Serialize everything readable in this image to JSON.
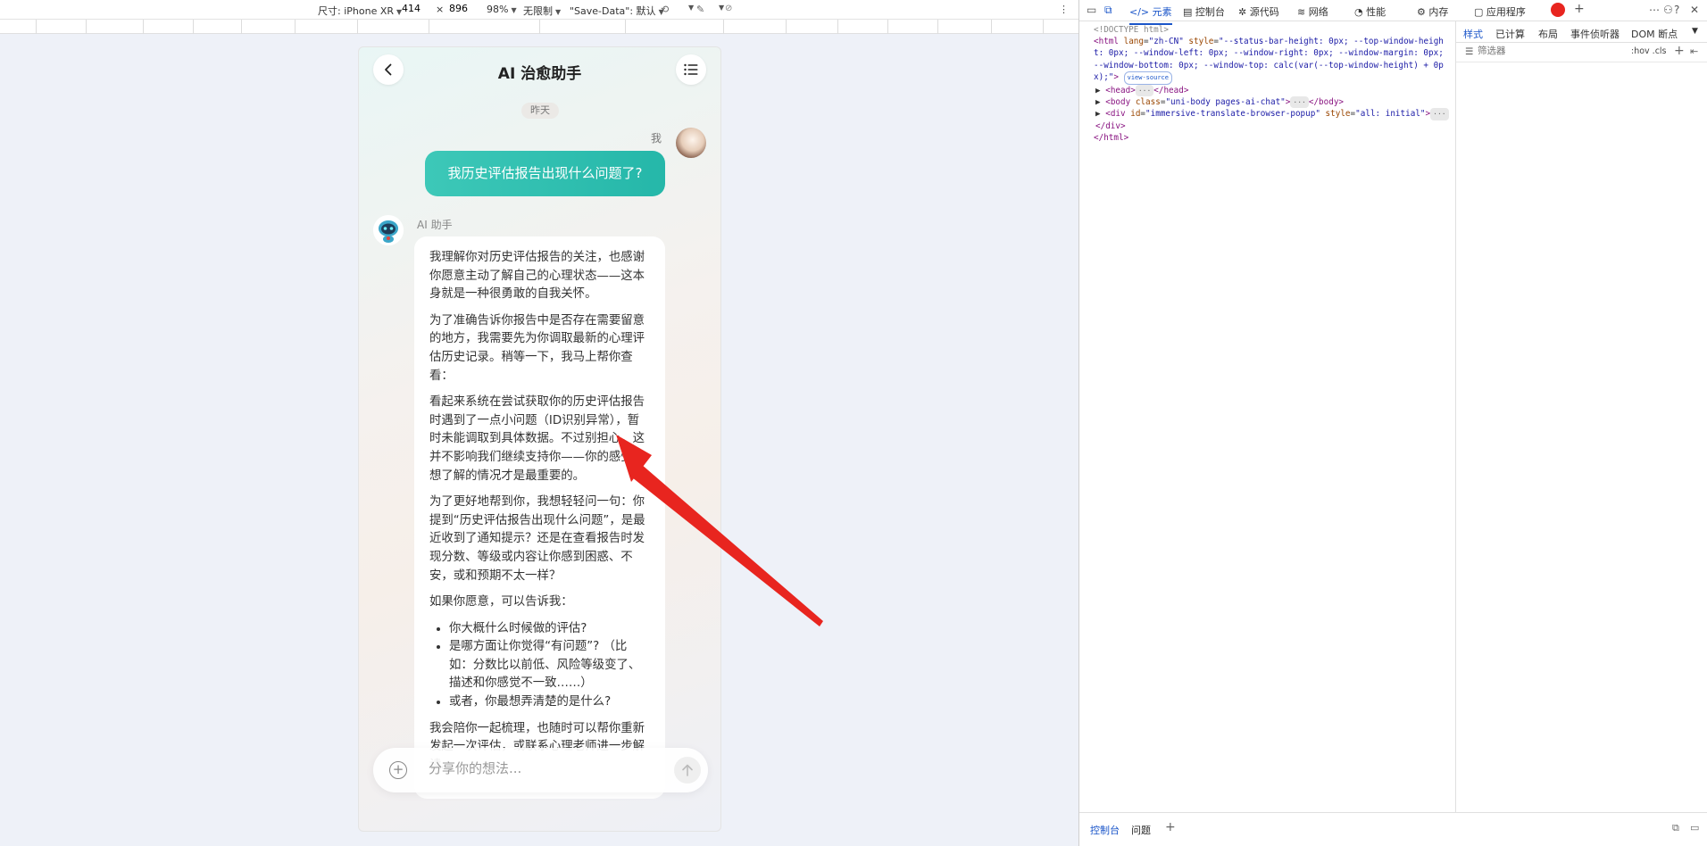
{
  "device_toolbar": {
    "dimensions_label": "尺寸: iPhone XR",
    "width": "414",
    "times": "×",
    "height": "896",
    "zoom": "98%",
    "throttle": "无限制",
    "save_data": "\"Save-Data\": 默认"
  },
  "app": {
    "title": "AI 治愈助手",
    "date_label": "昨天",
    "user_name": "我",
    "user_message": "我历史评估报告出现什么问题了?",
    "ai_name": "AI 助手",
    "ai_paragraphs": [
      "我理解你对历史评估报告的关注，也感谢你愿意主动了解自己的心理状态——这本身就是一种很勇敢的自我关怀。",
      "为了准确告诉你报告中是否存在需要留意的地方，我需要先为你调取最新的心理评估历史记录。稍等一下，我马上帮你查看：",
      "看起来系统在尝试获取你的历史评估报告时遇到了一点小问题（ID识别异常），暂时未能调取到具体数据。不过别担心，这并不影响我们继续支持你——你的感受和想了解的情况才是最重要的。",
      "为了更好地帮到你，我想轻轻问一句：你提到“历史评估报告出现什么问题”，是最近收到了通知提示？还是在查看报告时发现分数、等级或内容让你感到困惑、不安，或和预期不太一样？",
      "如果你愿意，可以告诉我："
    ],
    "ai_list": [
      "你大概什么时候做的评估?",
      "是哪方面让你觉得“有问题”? （比如：分数比以前低、风险等级变了、描述和你感觉不一致……）",
      "或者，你最想弄清楚的是什么?"
    ],
    "ai_tail": "我会陪你一起梳理，也随时可以帮你重新发起一次评估，或联系心理老师进一步解读。",
    "input_placeholder": "分享你的想法..."
  },
  "devtools": {
    "tabs": [
      "元素",
      "控制台",
      "源代码",
      "网络",
      "性能",
      "内存",
      "应用程序"
    ],
    "code_lines": {
      "doctype": "<!DOCTYPE html>",
      "html_open": "<html",
      "html_lang_attr": "lang",
      "html_lang_val": "\"zh-CN\"",
      "html_style_attr": "style",
      "html_style_val": "\"--status-bar-height: 0px; --top-window-height: 0px; --window-left: 0px; --window-right: 0px; --window-margin: 0px; --window-bottom: 0px; --window-top: calc(var(--top-window-height) + 0px);\"",
      "view_source": "view-source",
      "head_open": "<head>",
      "head_close": "</head>",
      "body_open": "<body",
      "body_class_attr": "class",
      "body_class_val": "\"uni-body pages-ai-chat\"",
      "body_close": "</body>",
      "div_open": "<div",
      "div_id_attr": "id",
      "div_id_val": "\"immersive-translate-browser-popup\"",
      "div_style_attr": "style",
      "div_style_val": "\"all: initial\"",
      "div_close": "</div>",
      "html_close": "</html>",
      "ellipsis": "···"
    },
    "side_tabs": [
      "样式",
      "已计算",
      "布局",
      "事件侦听器",
      "DOM 断点"
    ],
    "filter_label": "筛选器",
    "hov_cls": ":hov .cls",
    "drawer_tabs": [
      "控制台",
      "问题"
    ]
  },
  "colors": {
    "accent": "#25b7a9",
    "devtools_active": "#1a55c9",
    "arrow": "#e8251f"
  }
}
